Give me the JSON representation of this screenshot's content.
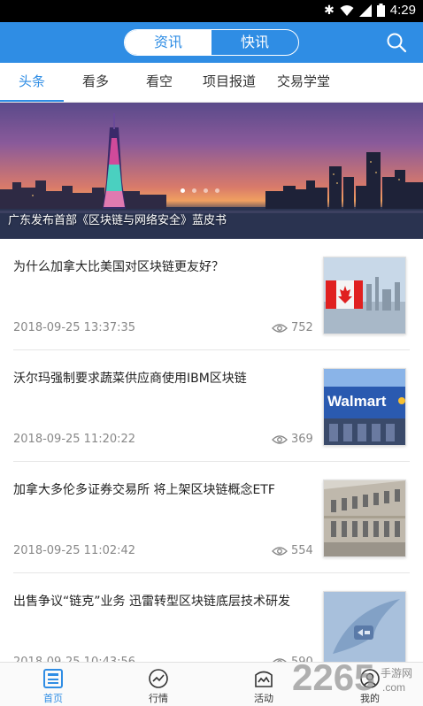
{
  "status_bar": {
    "time": "4:29"
  },
  "header": {
    "segments": [
      "资讯",
      "快讯"
    ],
    "active_segment": 0
  },
  "tabs": [
    "头条",
    "看多",
    "看空",
    "项目报道",
    "交易学堂"
  ],
  "active_tab": 0,
  "banner": {
    "caption": "广东发布首部《区块链与网络安全》蓝皮书",
    "dot_count": 4,
    "active_dot": 0
  },
  "news": [
    {
      "title": "为什么加拿大比美国对区块链更友好？",
      "time": "2018-09-25 13:37:35",
      "views": "752",
      "thumb": "canada-flag"
    },
    {
      "title": "沃尔玛强制要求蔬菜供应商使用IBM区块链",
      "time": "2018-09-25 11:20:22",
      "views": "369",
      "thumb": "walmart-store"
    },
    {
      "title": "加拿大多伦多证券交易所 将上架区块链概念ETF",
      "time": "2018-09-25 11:02:42",
      "views": "554",
      "thumb": "building"
    },
    {
      "title": "出售争议“链克”业务 迅雷转型区块链底层技术研发",
      "time": "2018-09-25 10:43:56",
      "views": "590",
      "thumb": "xunlei-logo"
    }
  ],
  "bottom_nav": [
    {
      "label": "首页",
      "icon": "home-icon"
    },
    {
      "label": "行情",
      "icon": "chart-icon"
    },
    {
      "label": "活动",
      "icon": "activity-icon"
    },
    {
      "label": "我的",
      "icon": "profile-icon"
    }
  ],
  "watermark": {
    "text": "2265",
    "subtext": "手游网",
    "domain": ".com"
  },
  "colors": {
    "primary": "#2f8de4",
    "text": "#222222",
    "muted": "#888888"
  }
}
